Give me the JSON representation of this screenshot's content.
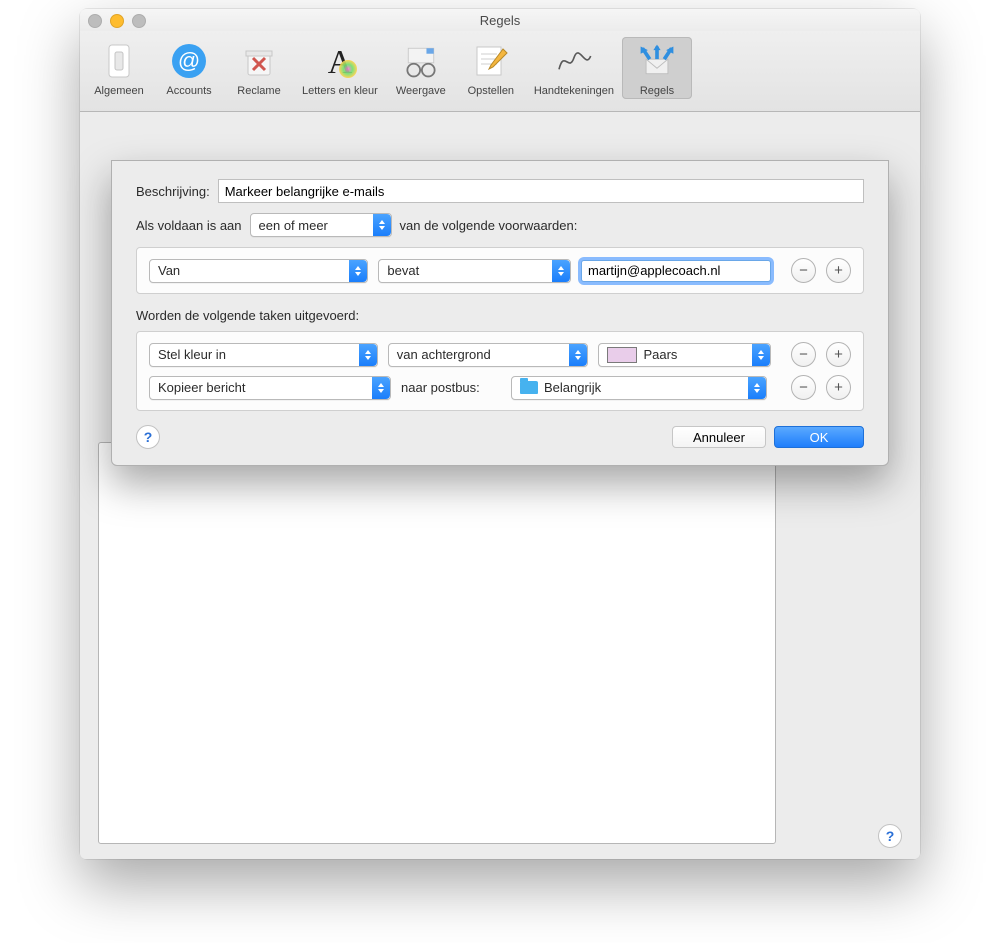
{
  "window": {
    "title": "Regels"
  },
  "toolbar": {
    "items": [
      {
        "label": "Algemeen"
      },
      {
        "label": "Accounts"
      },
      {
        "label": "Reclame"
      },
      {
        "label": "Letters en kleur"
      },
      {
        "label": "Weergave"
      },
      {
        "label": "Opstellen"
      },
      {
        "label": "Handtekeningen"
      },
      {
        "label": "Regels"
      }
    ],
    "active_index": 7
  },
  "sheet": {
    "description_label": "Beschrijving:",
    "description_value": "Markeer belangrijke e-mails",
    "cond_prefix": "Als voldaan is aan",
    "cond_match": "een of meer",
    "cond_suffix": "van de volgende voorwaarden:",
    "conditions": [
      {
        "field": "Van",
        "op": "bevat",
        "value": "martijn@applecoach.nl"
      }
    ],
    "actions_label": "Worden de volgende taken uitgevoerd:",
    "actions": [
      {
        "type": "Stel kleur in",
        "arg1": "van achtergrond",
        "color_name": "Paars"
      },
      {
        "type": "Kopieer bericht",
        "arg_label": "naar postbus:",
        "mailbox": "Belangrijk"
      }
    ],
    "buttons": {
      "cancel": "Annuleer",
      "ok": "OK"
    }
  }
}
